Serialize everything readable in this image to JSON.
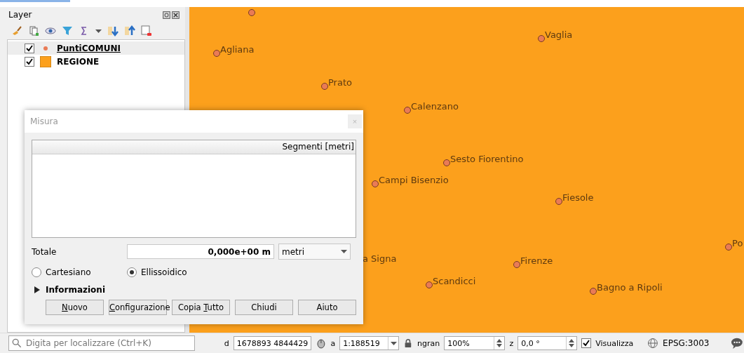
{
  "layers_panel": {
    "title": "Layer",
    "layers": [
      {
        "name": "PuntiCOMUNI",
        "checked": true,
        "selected": true,
        "kind": "point"
      },
      {
        "name": "REGIONE",
        "checked": true,
        "selected": false,
        "kind": "polygon"
      }
    ]
  },
  "map": {
    "places": [
      {
        "kind": "dot"
      },
      {
        "name": "Agliana",
        "kind": "dot"
      },
      {
        "name": "Vaglia",
        "kind": "dot"
      },
      {
        "name": "Prato",
        "kind": "dot"
      },
      {
        "name": "Calenzano",
        "kind": "dot"
      },
      {
        "name": "Sesto Fiorentino",
        "kind": "dot"
      },
      {
        "name": "Campi Bisenzio",
        "kind": "dot"
      },
      {
        "name": "Fiesole",
        "kind": "dot"
      },
      {
        "name": "a Signa",
        "kind": "label"
      },
      {
        "name": "Firenze",
        "kind": "dot"
      },
      {
        "name": "Scandicci",
        "kind": "dot"
      },
      {
        "name": "Bagno a Ripoli",
        "kind": "dot"
      },
      {
        "name": "Po",
        "kind": "dot"
      }
    ]
  },
  "dialog": {
    "title": "Misura",
    "close": "×",
    "table": {
      "column": "Segmenti [metri]"
    },
    "total_label": "Totale",
    "total_value": "0,000e+00 m",
    "unit": "metri",
    "modes": [
      {
        "label": "Cartesiano",
        "selected": false
      },
      {
        "label": "Ellissoidico",
        "selected": true
      }
    ],
    "info": {
      "label": "Informazioni",
      "expanded": false
    },
    "buttons": [
      {
        "mnemonic": "N",
        "rest": "uovo"
      },
      {
        "mnemonic": "C",
        "rest": "onfigurazione"
      },
      {
        "label": "Copia ",
        "mnemonic": "T",
        "rest": "utto"
      },
      {
        "label": "Chiudi"
      },
      {
        "label": "Aiuto"
      }
    ]
  },
  "status_bar": {
    "search_placeholder": "Digita per localizzare (Ctrl+K)",
    "coord_label": "d",
    "coordinate": "1678893 4844429",
    "scale_label": "a",
    "scale": "1:188519",
    "magnifier_label": "ngran",
    "magnifier": "100%",
    "rotation_label": "z",
    "rotation": "0,0 °",
    "render": {
      "label": "Visualizza",
      "checked": true
    },
    "crs": "EPSG:3003"
  }
}
